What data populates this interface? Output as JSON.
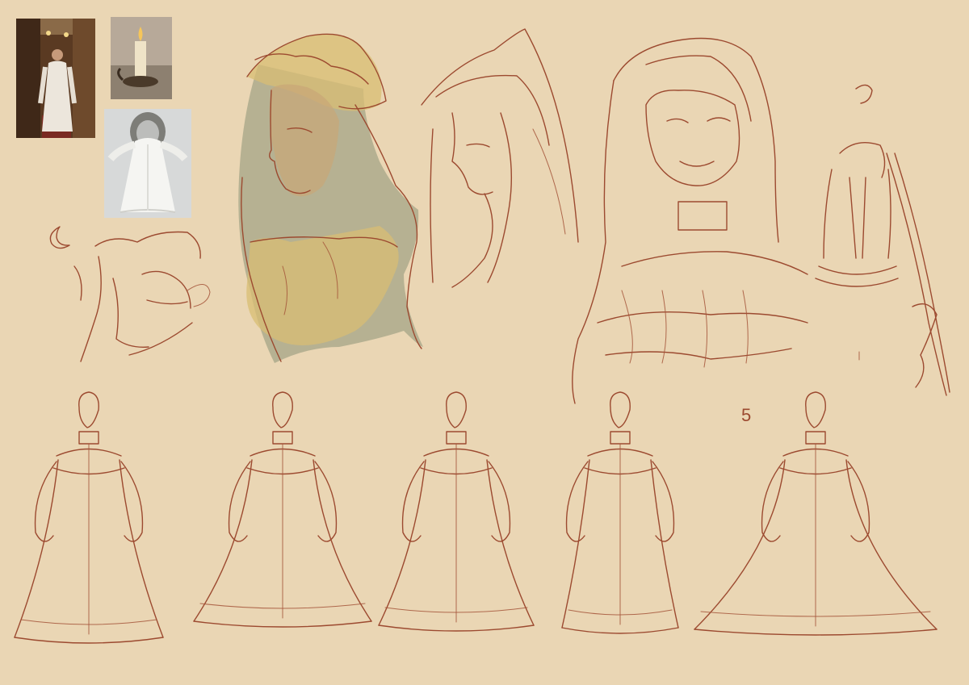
{
  "canvas": {
    "background": "#ead6b4",
    "line_color": "#9c4a30"
  },
  "reference_photos": [
    {
      "subject": "woman-in-white-nightgown-hallway-photo"
    },
    {
      "subject": "candle-in-holder-photo"
    },
    {
      "subject": "white-gown-on-mannequin-photo"
    }
  ],
  "sketches": {
    "head_studies": [
      "colored-bonnet-portrait",
      "profile-hood-sketch",
      "front-hood-sketch"
    ],
    "small_doodles": [
      "moon-glyph",
      "hair-shape-doodle",
      "candle-lamp-staff-sketch"
    ],
    "gown_figures": [
      "gown-figure-1",
      "gown-figure-2",
      "gown-figure-3",
      "gown-figure-4",
      "gown-figure-5"
    ],
    "figure_number_marks": [
      "5"
    ]
  }
}
